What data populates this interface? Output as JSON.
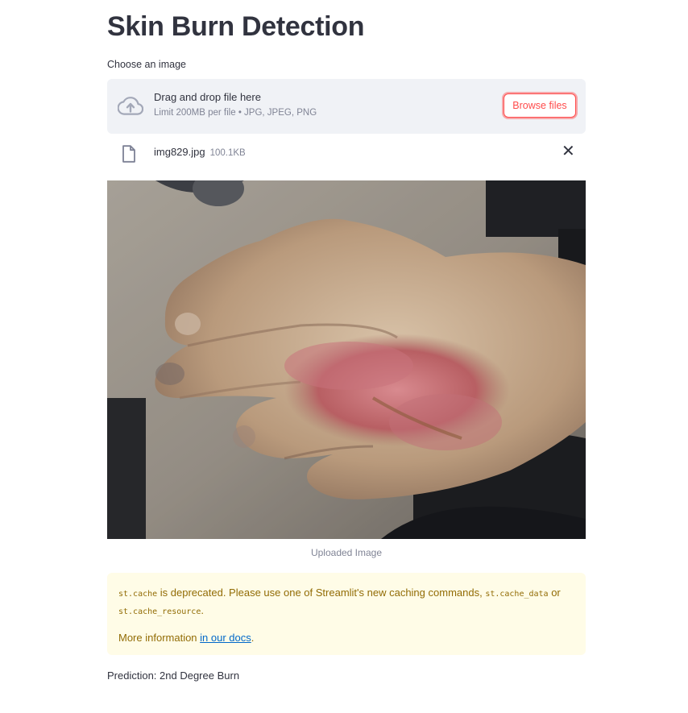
{
  "page": {
    "title": "Skin Burn Detection"
  },
  "uploader": {
    "label": "Choose an image",
    "drop_text": "Drag and drop file here",
    "limit_text": "Limit 200MB per file • JPG, JPEG, PNG",
    "browse_label": "Browse files",
    "upload_icon": "cloud-upload-icon"
  },
  "file": {
    "name": "img829.jpg",
    "size": "100.1KB",
    "icon": "file-icon",
    "remove_label": "✕"
  },
  "image": {
    "caption": "Uploaded Image"
  },
  "alert": {
    "code1": "st.cache",
    "text1": " is deprecated. Please use one of Streamlit's new caching commands, ",
    "code2": "st.cache_data",
    "text2": " or",
    "code3": "st.cache_resource",
    "text3": ".",
    "more_prefix": "More information ",
    "link_text": "in our docs",
    "more_suffix": "."
  },
  "prediction": "Prediction: 2nd Degree Burn",
  "colors": {
    "accent": "#ff4b4b",
    "text": "#31333f",
    "muted": "#808495",
    "dropzone_bg": "#f0f2f6",
    "warning_bg": "#fffce7",
    "warning_text": "#926c05",
    "link": "#0068c9"
  }
}
